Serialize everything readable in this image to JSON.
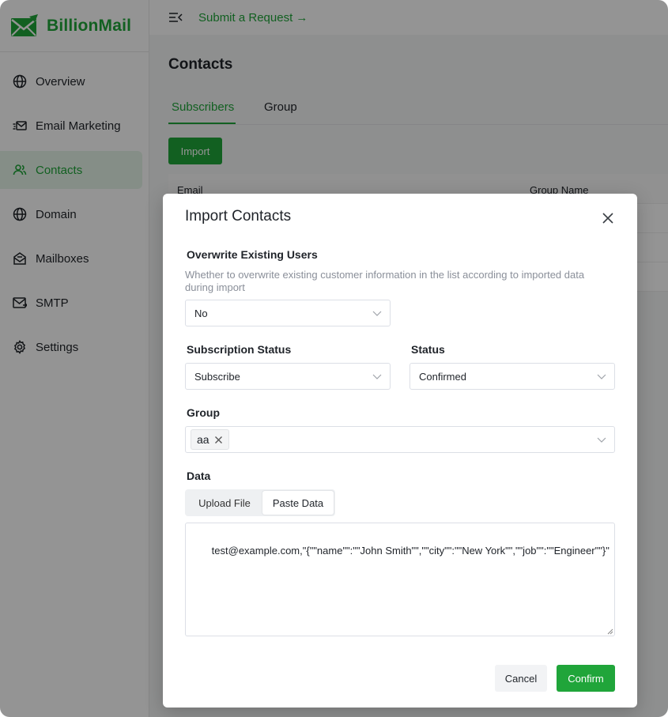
{
  "brand": {
    "name": "BillionMail",
    "logo_icon": "envelope-logo-icon",
    "color": "#20a53a"
  },
  "sidebar": {
    "items": [
      {
        "label": "Overview",
        "icon": "globe-icon",
        "active": false
      },
      {
        "label": "Email Marketing",
        "icon": "email-marketing-icon",
        "active": false
      },
      {
        "label": "Contacts",
        "icon": "contacts-icon",
        "active": true
      },
      {
        "label": "Domain",
        "icon": "globe-icon",
        "active": false
      },
      {
        "label": "Mailboxes",
        "icon": "mailbox-icon",
        "active": false
      },
      {
        "label": "SMTP",
        "icon": "smtp-icon",
        "active": false
      },
      {
        "label": "Settings",
        "icon": "gear-icon",
        "active": false
      }
    ]
  },
  "header": {
    "request_link": "Submit a Request",
    "menu_icon": "collapse-menu-icon"
  },
  "page": {
    "title": "Contacts",
    "tabs": [
      {
        "label": "Subscribers",
        "active": true
      },
      {
        "label": "Group",
        "active": false
      }
    ],
    "import_label": "Import",
    "table": {
      "columns": [
        "Email",
        "Group Name"
      ]
    }
  },
  "modal": {
    "title": "Import Contacts",
    "overwrite": {
      "label": "Overwrite Existing Users",
      "help": "Whether to overwrite existing customer information in the list according to imported data during import",
      "value": "No"
    },
    "subscription_status": {
      "label": "Subscription Status",
      "value": "Subscribe"
    },
    "status": {
      "label": "Status",
      "value": "Confirmed"
    },
    "group": {
      "label": "Group",
      "tags": [
        "aa"
      ]
    },
    "data": {
      "label": "Data",
      "options": [
        "Upload File",
        "Paste Data"
      ],
      "selected": "Paste Data",
      "content": "test@example.com,\"{\"\"name\"\":\"\"John Smith\"\",\"\"city\"\":\"\"New York\"\",\"\"job\"\":\"\"Engineer\"\"}\""
    },
    "cancel_label": "Cancel",
    "confirm_label": "Confirm"
  }
}
